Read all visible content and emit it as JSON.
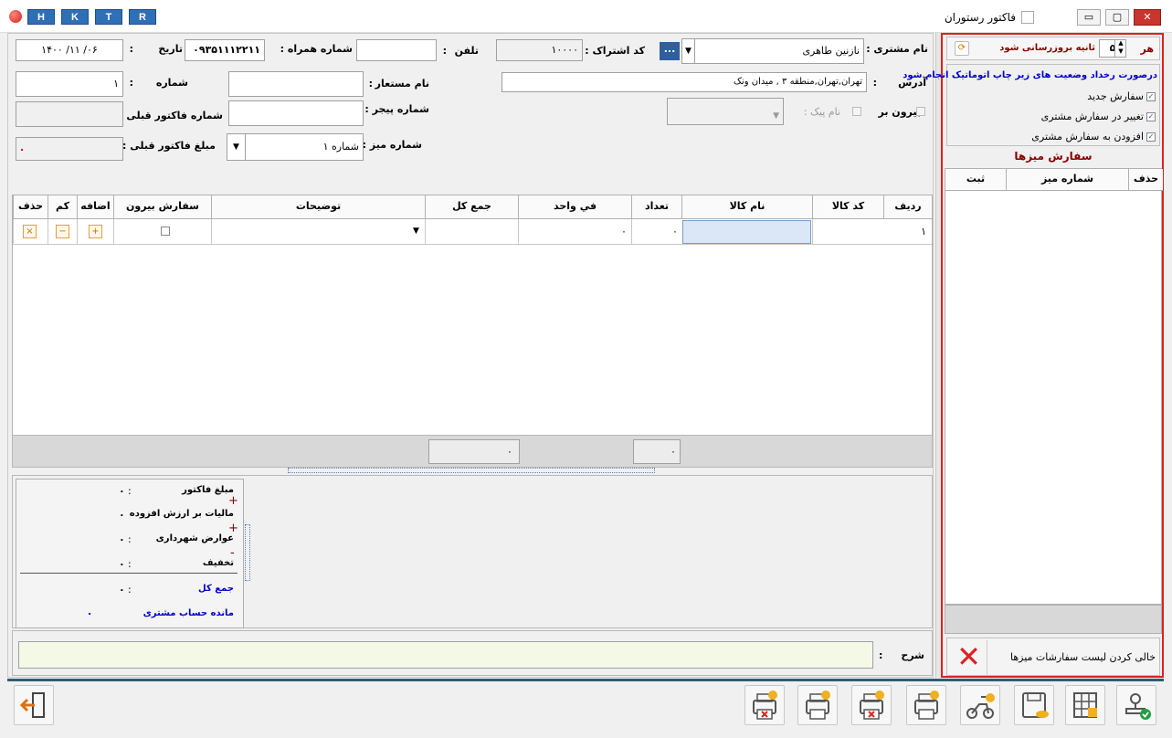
{
  "window": {
    "title": "فاکتور رستوران",
    "quick_buttons": [
      "H",
      "K",
      "T",
      "R"
    ],
    "minimize": "▭",
    "restore": "▢",
    "close": "✕"
  },
  "header": {
    "customer_name_label": "نام مشتری :",
    "customer_name_value": "نازنین طاهری",
    "sub_code_label": "کد اشتراک :",
    "sub_code_value": "۱۰۰۰۰",
    "dots": "...",
    "phone_label": "تلفن",
    "phone_colon": ":",
    "phone_value": "",
    "mobile_label": "شماره همراه :",
    "mobile_value": "۰۹۳۵۱۱۱۲۲۱۱",
    "date_label": "تاریخ",
    "date_colon": ":",
    "date_value": "۱۴۰۰  /۱۱  /۰۶",
    "address_label": "آدرس",
    "address_colon": ":",
    "address_value": "تهران,تهران,منطقه ۳ , میدان ونک",
    "alias_label": "نام مستعار",
    "alias_colon": ":",
    "alias_value": "",
    "number_label": "شماره",
    "number_colon": ":",
    "number_value": "۱",
    "outside_label": "بیرون بر",
    "courier_label": "نام پیک :",
    "pager_label": "شماره پیجر :",
    "prev_invoice_label": "شماره فاکتور قبلی :",
    "prev_invoice_value": "",
    "table_no_label": "شماره میز :",
    "table_no_value": "شماره ۱",
    "prev_amount_label": "مبلغ فاکتور قبلی :",
    "prev_amount_value": "."
  },
  "items_grid": {
    "columns": [
      "ردیف",
      "کد کالا",
      "نام کالا",
      "تعداد",
      "في واحد",
      "جمع کل",
      "توضیحات",
      "سفارش بیرون",
      "اضافه",
      "کم",
      "حذف"
    ],
    "rows": [
      {
        "row": "۱",
        "code": "",
        "name": "",
        "qty": "۰",
        "unit": "۰",
        "total": "",
        "desc": "",
        "outside": "",
        "add": "+",
        "less": "−",
        "del": "×"
      }
    ],
    "footer_qty": "۰",
    "footer_total": "۰"
  },
  "summary": {
    "invoice_amount_label": "مبلغ فاکتور",
    "invoice_amount_value": "۰",
    "vat_label": "مالیات بر ارزش افزوده",
    "vat_value": "۰",
    "municipal_label": "عوارض شهرداری",
    "municipal_value": "۰",
    "discount_label": "تخفیف",
    "discount_value": "۰",
    "grand_total_label": "جمع کل",
    "grand_total_value": "۰",
    "balance_label": "مانده حساب مشتری",
    "balance_value": ".",
    "colon": ":",
    "plus": "+",
    "minus": "-"
  },
  "notes": {
    "label": "شرح",
    "colon": ":",
    "value": ""
  },
  "side_panel": {
    "every_label": "هر",
    "seconds_value": "۵",
    "refresh_label": "ثانیه بروزرسانی شود",
    "auto_print_label": "درصورت رخداد وضعیت های زیر چاپ اتوماتیک انجام شود",
    "options": [
      "سفارش جدید",
      "تغییر در سفارش مشتری",
      "افزودن به سفارش مشتری"
    ],
    "tables_title": "سفارش میزها",
    "tables_columns": [
      "حذف",
      "شماره میز",
      "ثبت"
    ],
    "clear_label": "خالی کردن لیست سفارشات میزها"
  },
  "colors": {
    "accent_red": "#e02020",
    "title_blue": "#2f6fb6",
    "selected_cell": "#dbe7f6"
  }
}
